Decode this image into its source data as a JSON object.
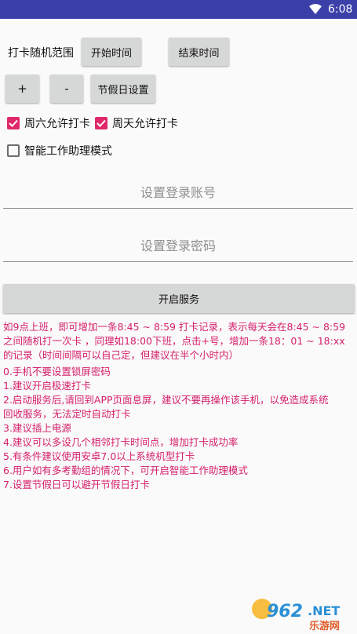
{
  "status": {
    "time": "6:08",
    "icons": [
      "wifi-icon"
    ]
  },
  "range_label": "打卡随机范围",
  "buttons": {
    "start_time": "开始时间",
    "end_time": "结束时间",
    "plus": "+",
    "minus": "-",
    "holiday": "节假日设置",
    "start_service": "开启服务"
  },
  "checkboxes": {
    "saturday": {
      "label": "周六允许打卡",
      "checked": true
    },
    "sunday": {
      "label": "周天允许打卡",
      "checked": true
    },
    "smart_mode": {
      "label": "智能工作助理模式",
      "checked": false
    }
  },
  "inputs": {
    "account_placeholder": "设置登录账号",
    "password_placeholder": "设置登录密码"
  },
  "info_paragraph": [
    "如9点上班，即可增加一条8:45 ~ 8:59 打卡记录，表示每天会在8:45 ~ 8:59",
    "之间随机打一次卡 ，同理如18:00下班，点击+号，增加一条18：01 ~ 18:xx",
    "的记录（时间间隔可以自己定，但建议在半个小时内）"
  ],
  "tips": [
    "0.手机不要设置锁屏密码",
    "1.建议开启极速打卡",
    "2.启动服务后,请回到APP页面息屏，建议不要再操作该手机，以免造成系统",
    "回收服务，无法定时自动打卡",
    "3.建议插上电源",
    "4.建议可以多设几个相邻打卡时间点，增加打卡成功率",
    "5.有条件建议使用安卓7.0以上系统机型打卡",
    "6.用户如有多考勤组的情况下，可开启智能工作助理模式",
    "7.设置节假日可以避开节假日打卡"
  ],
  "watermark": {
    "logo": "962",
    "suffix": ".NET",
    "sub": "乐游网"
  },
  "colors": {
    "status_bar": "#3b3fa8",
    "accent": "#e0286b",
    "info_text": "#d5206c",
    "button": "#d6d7d7"
  }
}
